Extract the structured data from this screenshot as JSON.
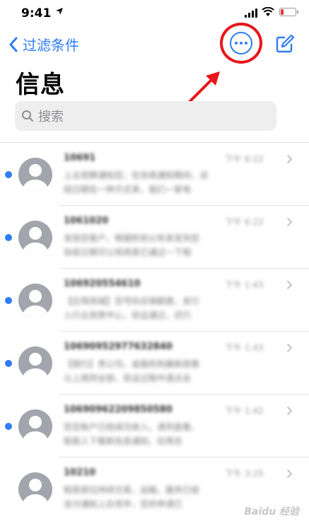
{
  "status_bar": {
    "time": "9:41",
    "battery_color": "#e53935"
  },
  "nav": {
    "back_label": "过滤条件",
    "more_icon": "more-circle-icon",
    "compose_icon": "compose-icon",
    "accent_color": "#2f7cf6"
  },
  "annotation": {
    "ring_color": "#e8161a",
    "arrow_color": "#e8161a"
  },
  "page": {
    "title": "信息"
  },
  "search": {
    "placeholder": "搜索"
  },
  "conversations": [
    {
      "sender": "10691",
      "time": "下午 6:22",
      "preview": "上业观察通知您，在协商通知期间，试\n结日期在一种方式来，我们一家电",
      "unread": true
    },
    {
      "sender": "1061020",
      "time": "下午 6:22",
      "preview": "发现您客户，根据检验公布来发到您\n验收日期可以将商家已通过一下相",
      "unread": true
    },
    {
      "sender": "106920554610",
      "time": "下午 1:43",
      "preview": "【应用商城】您号码总销额度，发行\n入行业资质中心，验证通过，还行",
      "unread": true
    },
    {
      "sender": "10690952977632840",
      "time": "下午 1:43",
      "preview": "【银行】贵公司，金融机构最新政策\n以上规则全部，验证过程中请点击",
      "unread": true
    },
    {
      "sender": "10690962209850580",
      "time": "下午 1:42",
      "preview": "您您账户已经成功收入，请到查看，\n取款人下载新信息通知，应用合",
      "unread": true
    },
    {
      "sender": "10210",
      "time": "下午 3:25",
      "preview": "取款部位持续交易，运输，服务已经\n支付通知上办完毕，您的申请已",
      "unread": false
    }
  ],
  "watermark": "Baidu 经验"
}
